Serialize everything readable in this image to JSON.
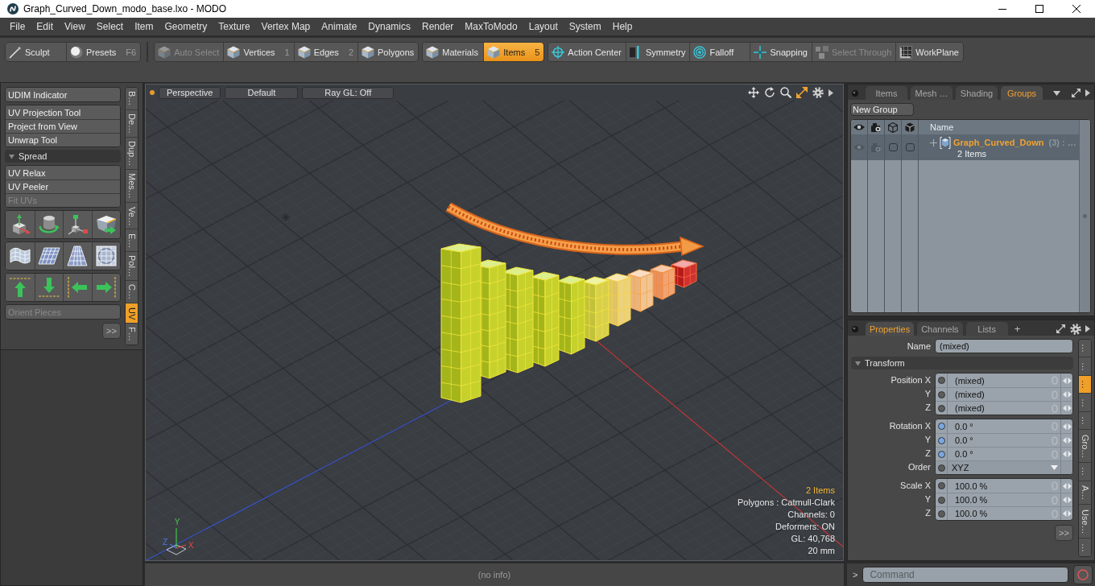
{
  "window": {
    "title": "Graph_Curved_Down_modo_base.lxo - MODO"
  },
  "menu": [
    "File",
    "Edit",
    "View",
    "Select",
    "Item",
    "Geometry",
    "Texture",
    "Vertex Map",
    "Animate",
    "Dynamics",
    "Render",
    "MaxToModo",
    "Layout",
    "System",
    "Help"
  ],
  "toolbar": [
    {
      "tools": [
        {
          "label": "Sculpt",
          "kind": "brush",
          "selected": false,
          "disabled": false
        },
        {
          "label": "Presets",
          "shortcut": "F6",
          "kind": "sphere",
          "selected": false,
          "disabled": false
        }
      ]
    },
    {
      "tools": [
        {
          "label": "Auto Select",
          "kind": "cube",
          "selected": false,
          "disabled": true
        },
        {
          "label": "Vertices",
          "shortcut": "1",
          "kind": "cube",
          "selected": false,
          "disabled": false
        },
        {
          "label": "Edges",
          "shortcut": "2",
          "kind": "cube",
          "selected": false,
          "disabled": false
        },
        {
          "label": "Polygons",
          "kind": "cube",
          "selected": false,
          "disabled": false
        }
      ]
    },
    {
      "tools": [
        {
          "label": "Materials",
          "kind": "cube",
          "selected": false,
          "disabled": false
        },
        {
          "label": "Items",
          "shortcut": "5",
          "kind": "cube",
          "selected": true,
          "disabled": false
        }
      ]
    },
    {
      "tools": [
        {
          "label": "Action Center",
          "kind": "crosshair",
          "selected": false,
          "disabled": false
        },
        {
          "label": "Symmetry",
          "kind": "mirror",
          "selected": false,
          "disabled": false
        },
        {
          "label": "Falloff",
          "kind": "target",
          "selected": false,
          "disabled": false
        },
        {
          "label": "Snapping",
          "kind": "snap",
          "selected": false,
          "disabled": false
        },
        {
          "label": "Select Through",
          "kind": "cubes",
          "selected": false,
          "disabled": true
        },
        {
          "label": "WorkPlane",
          "kind": "grid",
          "selected": false,
          "disabled": false
        }
      ]
    }
  ],
  "left_panel": {
    "sections": [
      {
        "kind": "buttons",
        "items": [
          {
            "label": "UDIM Indicator",
            "disabled": false
          }
        ]
      },
      {
        "kind": "buttons",
        "items": [
          {
            "label": "UV Projection Tool",
            "disabled": false
          },
          {
            "label": "Project from View",
            "disabled": false
          },
          {
            "label": "Unwrap Tool",
            "disabled": false
          }
        ]
      },
      {
        "kind": "header",
        "label": "Spread",
        "expanded": true
      },
      {
        "kind": "buttons",
        "items": [
          {
            "label": "UV Relax",
            "disabled": false
          },
          {
            "label": "UV Peeler",
            "disabled": false
          },
          {
            "label": "Fit UVs",
            "disabled": true
          }
        ]
      },
      {
        "kind": "icons",
        "items": [
          {
            "kind": "axes-cube"
          },
          {
            "kind": "cylinder-rotate"
          },
          {
            "kind": "axes"
          },
          {
            "kind": "box-arrow"
          }
        ]
      },
      {
        "kind": "icons",
        "items": [
          {
            "kind": "curved-grid"
          },
          {
            "kind": "plane-grid"
          },
          {
            "kind": "trapezoid-grid"
          },
          {
            "kind": "sphere-grid"
          }
        ]
      },
      {
        "kind": "icons",
        "items": [
          {
            "kind": "arrow-up"
          },
          {
            "kind": "arrow-down"
          },
          {
            "kind": "arrow-left"
          },
          {
            "kind": "arrow-right"
          }
        ]
      },
      {
        "kind": "buttons",
        "items": [
          {
            "label": "Orient Pieces",
            "disabled": true
          }
        ]
      }
    ],
    "more_button": ">>",
    "tabs": [
      {
        "label": "B…",
        "selected": false
      },
      {
        "label": "De…",
        "selected": false
      },
      {
        "label": "Dup…",
        "selected": false
      },
      {
        "label": "Mes…",
        "selected": false
      },
      {
        "label": "Ve…",
        "selected": false
      },
      {
        "label": "E…",
        "selected": false
      },
      {
        "label": "Pol…",
        "selected": false
      },
      {
        "label": "C…",
        "selected": false
      },
      {
        "label": "UV",
        "selected": true
      },
      {
        "label": "F…",
        "selected": false
      }
    ]
  },
  "viewport": {
    "view_buttons": [
      "Perspective",
      "Default",
      "Ray GL: Off"
    ],
    "axis_labels": [
      {
        "kind": "y",
        "label": "Y"
      },
      {
        "kind": "z",
        "label": "Z"
      },
      {
        "kind": "x",
        "label": "X"
      }
    ],
    "stats": [
      {
        "text": "2 Items",
        "highlighted": true
      },
      {
        "text": "Polygons : Catmull-Clark",
        "highlighted": false
      },
      {
        "text": "Channels: 0",
        "highlighted": false
      },
      {
        "text": "Deformers: ON",
        "highlighted": false
      },
      {
        "text": "GL: 40,768",
        "highlighted": false
      },
      {
        "text": "20 mm",
        "highlighted": false
      }
    ]
  },
  "groups_panel": {
    "tabs": [
      {
        "label": "Items",
        "selected": false
      },
      {
        "label": "Mesh …",
        "selected": false
      },
      {
        "label": "Shading",
        "selected": false
      },
      {
        "label": "Groups",
        "selected": true
      }
    ],
    "new_group": "New Group",
    "icon_columns": [
      {
        "kind": "eye"
      },
      {
        "kind": "camera"
      },
      {
        "kind": "cube"
      },
      {
        "kind": "cube-lock"
      }
    ],
    "name_column": "Name",
    "rows": [
      {
        "cells": [
          {
            "kind": "eye"
          },
          {
            "kind": "camera"
          },
          {
            "kind": "checkbox",
            "checked": false
          },
          {
            "kind": "checkbox",
            "checked": false
          }
        ],
        "expanded": false,
        "name": "Graph_Curved_Down",
        "count": "(3) : …",
        "detail": "2 Items"
      }
    ]
  },
  "properties": {
    "tabs": [
      {
        "label": "Properties",
        "selected": true
      },
      {
        "label": "Channels",
        "selected": false
      },
      {
        "label": "Lists",
        "selected": false
      }
    ],
    "add_tab": "+",
    "name": {
      "label": "Name",
      "value": "(mixed)"
    },
    "section": {
      "title": "Transform",
      "expanded": true
    },
    "groups": [
      {
        "rows": [
          {
            "kind": "field",
            "label": "Position X",
            "value": "(mixed)",
            "color": "#5c5c5c"
          },
          {
            "kind": "field",
            "label": "Y",
            "value": "(mixed)",
            "color": "#5c5c5c"
          },
          {
            "kind": "field",
            "label": "Z",
            "value": "(mixed)",
            "color": "#5c5c5c"
          }
        ]
      },
      {
        "rows": [
          {
            "kind": "field",
            "label": "Rotation X",
            "value": "0.0 °",
            "color": "#7aa7e3"
          },
          {
            "kind": "field",
            "label": "Y",
            "value": "0.0 °",
            "color": "#7aa7e3"
          },
          {
            "kind": "field",
            "label": "Z",
            "value": "0.0 °",
            "color": "#7aa7e3"
          },
          {
            "kind": "dropdown",
            "label": "Order",
            "value": "XYZ",
            "color": "#5c5c5c"
          }
        ]
      },
      {
        "rows": [
          {
            "kind": "field",
            "label": "Scale X",
            "value": "100.0 %",
            "color": "#5c5c5c"
          },
          {
            "kind": "field",
            "label": "Y",
            "value": "100.0 %",
            "color": "#5c5c5c"
          },
          {
            "kind": "field",
            "label": "Z",
            "value": "100.0 %",
            "color": "#5c5c5c"
          }
        ]
      }
    ],
    "more_button": ">>",
    "side_tabs": [
      {
        "label": "…",
        "selected": false
      },
      {
        "label": "…",
        "selected": false
      },
      {
        "label": "…",
        "selected": true
      },
      {
        "label": "…",
        "selected": false
      },
      {
        "label": "…",
        "selected": false
      },
      {
        "label": "Gro…",
        "selected": false
      },
      {
        "label": "…",
        "selected": false
      },
      {
        "label": "A…",
        "selected": false
      },
      {
        "label": "Use…",
        "selected": false
      },
      {
        "label": "…",
        "selected": false
      }
    ]
  },
  "status_bar": {
    "text": "(no info)"
  },
  "command_bar": {
    "prompt": ">",
    "placeholder": "Command"
  }
}
